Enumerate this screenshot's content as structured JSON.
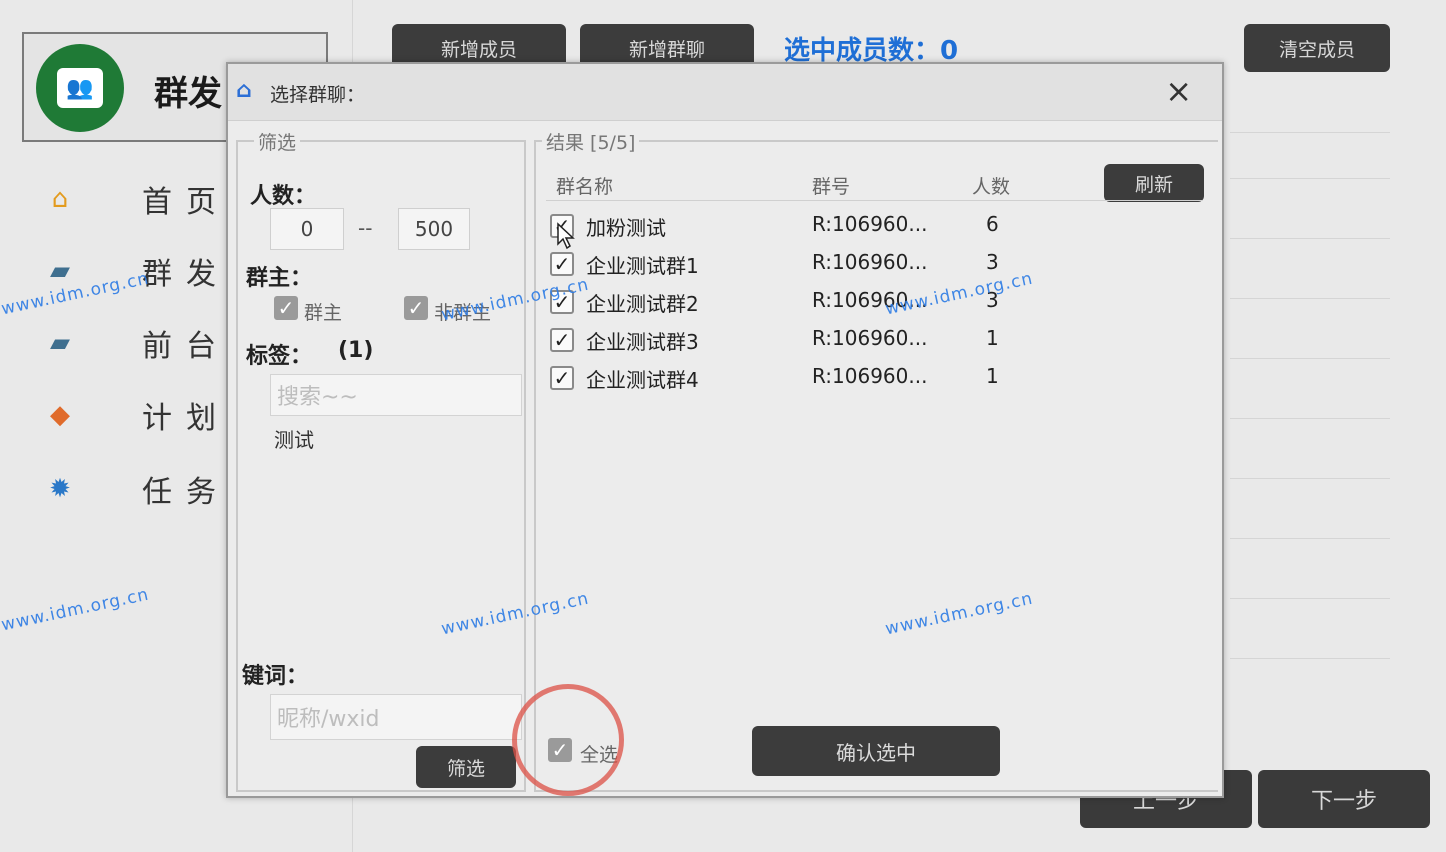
{
  "app": {
    "title": "群发",
    "logo_icon": "chat-group-icon",
    "brand_color": "#1f7a36"
  },
  "nav": {
    "items": [
      {
        "label": "首页讠",
        "icon": "home-icon"
      },
      {
        "label": "群发1",
        "icon": "stack-icon"
      },
      {
        "label": "前台1",
        "icon": "stack-icon"
      },
      {
        "label": "计划1",
        "icon": "package-icon"
      },
      {
        "label": "任务|",
        "icon": "gear-icon"
      }
    ]
  },
  "toolbar": {
    "add_member": "新增成员",
    "add_group": "新增群聊",
    "selected_count": "选中成员数：0",
    "clear_members": "清空成员"
  },
  "footer": {
    "prev": "上一步",
    "next": "下一步"
  },
  "dialog": {
    "title": "选择群聊：",
    "close": "×",
    "filter": {
      "legend": "筛选",
      "people_label": "人数：",
      "min": "0",
      "dash": "--",
      "max": "500",
      "owner_label": "群主：",
      "owner_option": "群主",
      "non_owner_option": "非群主",
      "tags_label": "标签：",
      "tags_count": "(1)",
      "tag_search_placeholder": "搜索~~",
      "tags": [
        "测试"
      ],
      "keyword_label": "键词：",
      "keyword_placeholder": "昵称/wxid",
      "filter_button": "筛选"
    },
    "results": {
      "legend": "结果 [5/5]",
      "headers": {
        "name": "群名称",
        "id": "群号",
        "count": "人数"
      },
      "refresh_button": "刷新",
      "rows": [
        {
          "name": "加粉测试",
          "id": "R:106960...",
          "count": "6"
        },
        {
          "name": "企业测试群1",
          "id": "R:106960...",
          "count": "3"
        },
        {
          "name": "企业测试群2",
          "id": "R:106960...",
          "count": "3"
        },
        {
          "name": "企业测试群3",
          "id": "R:106960...",
          "count": "1"
        },
        {
          "name": "企业测试群4",
          "id": "R:106960...",
          "count": "1"
        }
      ],
      "select_all": "全选",
      "confirm_button": "确认选中"
    }
  },
  "watermark": "www.idm.org.cn",
  "accent_color": "#1f6fd6"
}
